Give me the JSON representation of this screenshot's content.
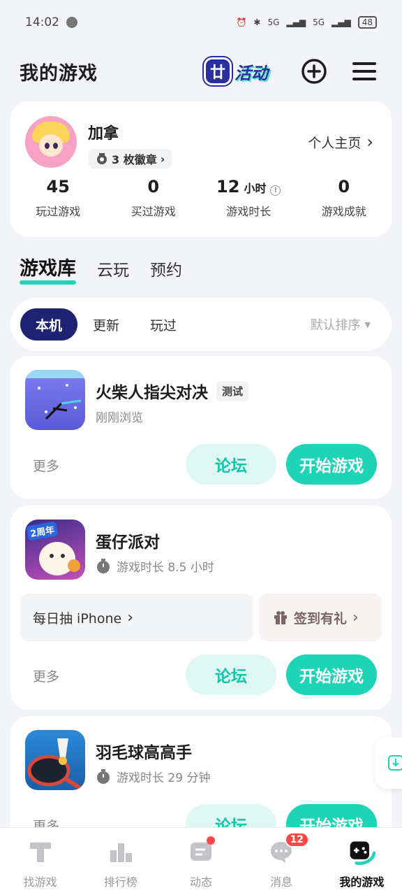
{
  "status_bar": {
    "time": "14:02",
    "signal_1": "5G",
    "signal_2": "5G",
    "battery": "48"
  },
  "header": {
    "title": "我的游戏",
    "activity_tv": "廿",
    "activity_label": "活动"
  },
  "profile": {
    "name": "加拿",
    "badge_text": "3 枚徽章",
    "profile_link": "个人主页",
    "stats": [
      {
        "value": "45",
        "unit": "",
        "label": "玩过游戏"
      },
      {
        "value": "0",
        "unit": "",
        "label": "买过游戏"
      },
      {
        "value": "12",
        "unit": "小时",
        "label": "游戏时长"
      },
      {
        "value": "0",
        "unit": "",
        "label": "游戏成就"
      }
    ]
  },
  "main_tabs": [
    "游戏库",
    "云玩",
    "预约"
  ],
  "filters": {
    "chips": [
      "本机",
      "更新",
      "玩过"
    ],
    "sort_label": "默认排序"
  },
  "games": [
    {
      "title": "火柴人指尖对决",
      "tag": "测试",
      "subtitle": "刚刚浏览",
      "more": "更多",
      "forum": "论坛",
      "start": "开始游戏"
    },
    {
      "title": "蛋仔派对",
      "subtitle": "游戏时长 8.5 小时",
      "icon_badge": "2周年",
      "promo_left": "每日抽 iPhone",
      "promo_right": "签到有礼",
      "more": "更多",
      "forum": "论坛",
      "start": "开始游戏"
    },
    {
      "title": "羽毛球高高手",
      "subtitle": "游戏时长 29 分钟",
      "more": "更多",
      "forum": "论坛",
      "start": "开始游戏"
    }
  ],
  "bottom_nav": [
    {
      "label": "找游戏",
      "icon": "find-game-icon"
    },
    {
      "label": "排行榜",
      "icon": "ranking-icon"
    },
    {
      "label": "动态",
      "icon": "feed-icon",
      "dot": true
    },
    {
      "label": "消息",
      "icon": "message-icon",
      "count": "12"
    },
    {
      "label": "我的游戏",
      "icon": "gamepad-icon",
      "active": true
    }
  ],
  "colors": {
    "accent": "#1ed4b6",
    "navy": "#1e2272",
    "badge_red": "#ff4747"
  }
}
